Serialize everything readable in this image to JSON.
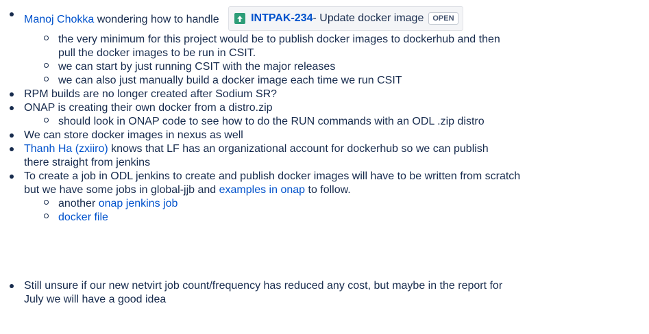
{
  "items": [
    {
      "mention": "Manoj Chokka",
      "text": " wondering how to handle",
      "jira": {
        "key": "INTPAK-234",
        "summary": " - Update docker image",
        "status": "OPEN"
      },
      "sub": [
        "the very minimum for this project would be to publish docker images to dockerhub and then",
        "pull the docker images to be run in CSIT.",
        "we can start by just running CSIT with the major releases",
        "we can also just manually build a docker image each time we run CSIT"
      ]
    },
    {
      "text": "RPM builds are no longer created after Sodium SR?"
    },
    {
      "text": "ONAP is creating their own docker from a distro.zip",
      "sub": [
        "should look in ONAP code to see how to do the RUN commands with an ODL .zip distro"
      ]
    },
    {
      "text": "We can store docker images in nexus as well"
    },
    {
      "mention": "Thanh Ha (zxiiro)",
      "text_a": " knows that LF has an organizational account for dockerhub so we can publish",
      "text_b": "there straight from jenkins"
    },
    {
      "text_a": "To create a job in ODL jenkins to create and publish docker images will have to be written from scratch",
      "text_b": "but we have some jobs in global-jjb and ",
      "link": "examples in onap",
      "text_c": " to follow.",
      "sub_prefix": "another ",
      "sub_link1": "onap jenkins job",
      "sub_link2": "docker file"
    },
    {
      "text_a": "Still unsure if our new netvirt job count/frequency has reduced any cost, but maybe in the report for",
      "text_b": "July we will have a good idea"
    }
  ]
}
